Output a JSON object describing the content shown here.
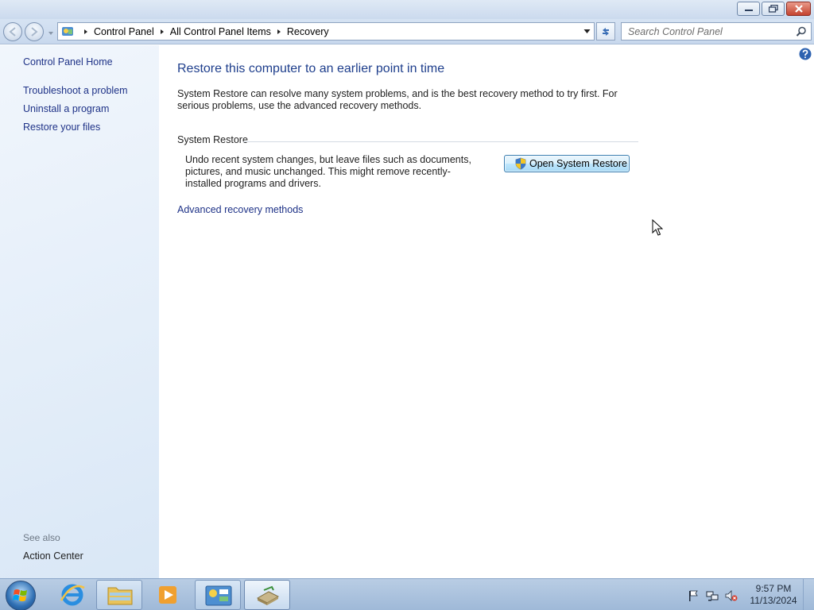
{
  "window": {
    "controls": {
      "minimize_icon": "minimize-icon",
      "restore_icon": "restore-icon",
      "close_icon": "close-icon"
    }
  },
  "navigation": {
    "breadcrumb": [
      "Control Panel",
      "All Control Panel Items",
      "Recovery"
    ],
    "search_placeholder": "Search Control Panel"
  },
  "sidebar": {
    "home_label": "Control Panel Home",
    "items": [
      {
        "label": "Troubleshoot a problem"
      },
      {
        "label": "Uninstall a program"
      },
      {
        "label": "Restore your files"
      }
    ],
    "see_also_label": "See also",
    "see_also_items": [
      {
        "label": "Action Center"
      }
    ]
  },
  "main": {
    "heading": "Restore this computer to an earlier point in time",
    "intro": "System Restore can resolve many system problems, and is the best recovery method to try first. For serious problems, use the advanced recovery methods.",
    "group_title": "System Restore",
    "group_description": "Undo recent system changes, but leave files such as documents, pictures, and music unchanged. This might remove recently-installed programs and drivers.",
    "button_label": "Open System Restore",
    "advanced_link": "Advanced recovery methods"
  },
  "taskbar": {
    "clock_time": "9:57 PM",
    "clock_date": "11/13/2024"
  },
  "colors": {
    "link": "#1e3287",
    "heading": "#1e3e8c",
    "sidebar_bg": "#e4eef9"
  }
}
